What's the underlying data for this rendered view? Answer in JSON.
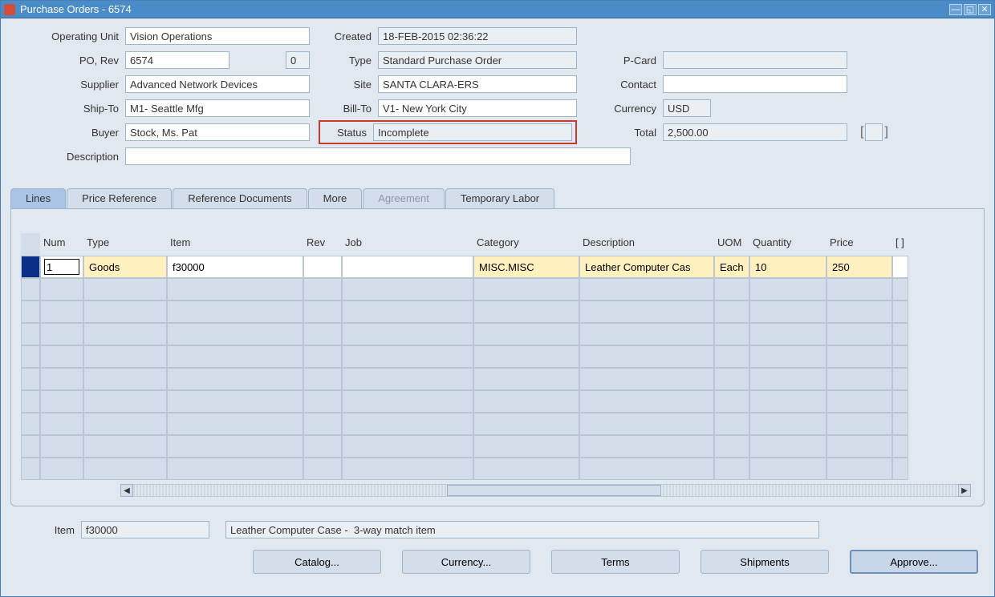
{
  "window": {
    "title": "Purchase Orders - 6574"
  },
  "header": {
    "operating_unit_label": "Operating Unit",
    "operating_unit": "Vision Operations",
    "po_rev_label": "PO, Rev",
    "po_num": "6574",
    "rev": "0",
    "supplier_label": "Supplier",
    "supplier": "Advanced Network Devices",
    "ship_to_label": "Ship-To",
    "ship_to": "M1- Seattle Mfg",
    "buyer_label": "Buyer",
    "buyer": "Stock, Ms. Pat",
    "description_label": "Description",
    "description": "",
    "created_label": "Created",
    "created": "18-FEB-2015 02:36:22",
    "type_label": "Type",
    "type": "Standard Purchase Order",
    "site_label": "Site",
    "site": "SANTA CLARA-ERS",
    "bill_to_label": "Bill-To",
    "bill_to": "V1- New York City",
    "status_label": "Status",
    "status": "Incomplete",
    "pcard_label": "P-Card",
    "pcard": "",
    "contact_label": "Contact",
    "contact": "",
    "currency_label": "Currency",
    "currency": "USD",
    "total_label": "Total",
    "total": "2,500.00"
  },
  "tabs": {
    "lines": "Lines",
    "price_reference": "Price Reference",
    "reference_documents": "Reference Documents",
    "more": "More",
    "agreement": "Agreement",
    "temporary_labor": "Temporary Labor"
  },
  "grid": {
    "headers": {
      "num": "Num",
      "type": "Type",
      "item": "Item",
      "rev": "Rev",
      "job": "Job",
      "category": "Category",
      "description": "Description",
      "uom": "UOM",
      "quantity": "Quantity",
      "price": "Price",
      "flex": "[   ]"
    },
    "rows": [
      {
        "num": "1",
        "type": "Goods",
        "item": "f30000",
        "rev": "",
        "job": "",
        "category": "MISC.MISC",
        "description": "Leather Computer Cas",
        "uom": "Each",
        "quantity": "10",
        "price": "250"
      }
    ]
  },
  "footer": {
    "item_label": "Item",
    "item": "f30000",
    "item_desc": "Leather Computer Case -  3-way match item"
  },
  "buttons": {
    "catalog": "Catalog...",
    "currency": "Currency...",
    "terms": "Terms",
    "shipments": "Shipments",
    "approve": "Approve..."
  }
}
